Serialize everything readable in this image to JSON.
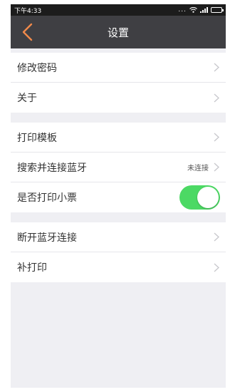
{
  "status_bar": {
    "time": "下午4:33",
    "more_dots": "..."
  },
  "nav": {
    "title": "设置"
  },
  "groups": [
    {
      "items": [
        {
          "label": "修改密码"
        },
        {
          "label": "关于"
        }
      ]
    },
    {
      "items": [
        {
          "label": "打印模板"
        },
        {
          "label": "搜索并连接蓝牙",
          "value": "未连接"
        },
        {
          "label": "是否打印小票",
          "toggle_on": true
        }
      ]
    },
    {
      "items": [
        {
          "label": "断开蓝牙连接"
        },
        {
          "label": "补打印"
        }
      ]
    }
  ],
  "colors": {
    "accent": "#f08a4b",
    "navbar": "#3f3f43",
    "toggle_on": "#4cd964",
    "background": "#efeff3"
  },
  "icons": {
    "back": "chevron-left-icon",
    "row_disclosure": "chevron-right-icon",
    "wifi": "wifi-icon",
    "signal": "signal-icon",
    "battery": "battery-icon"
  }
}
